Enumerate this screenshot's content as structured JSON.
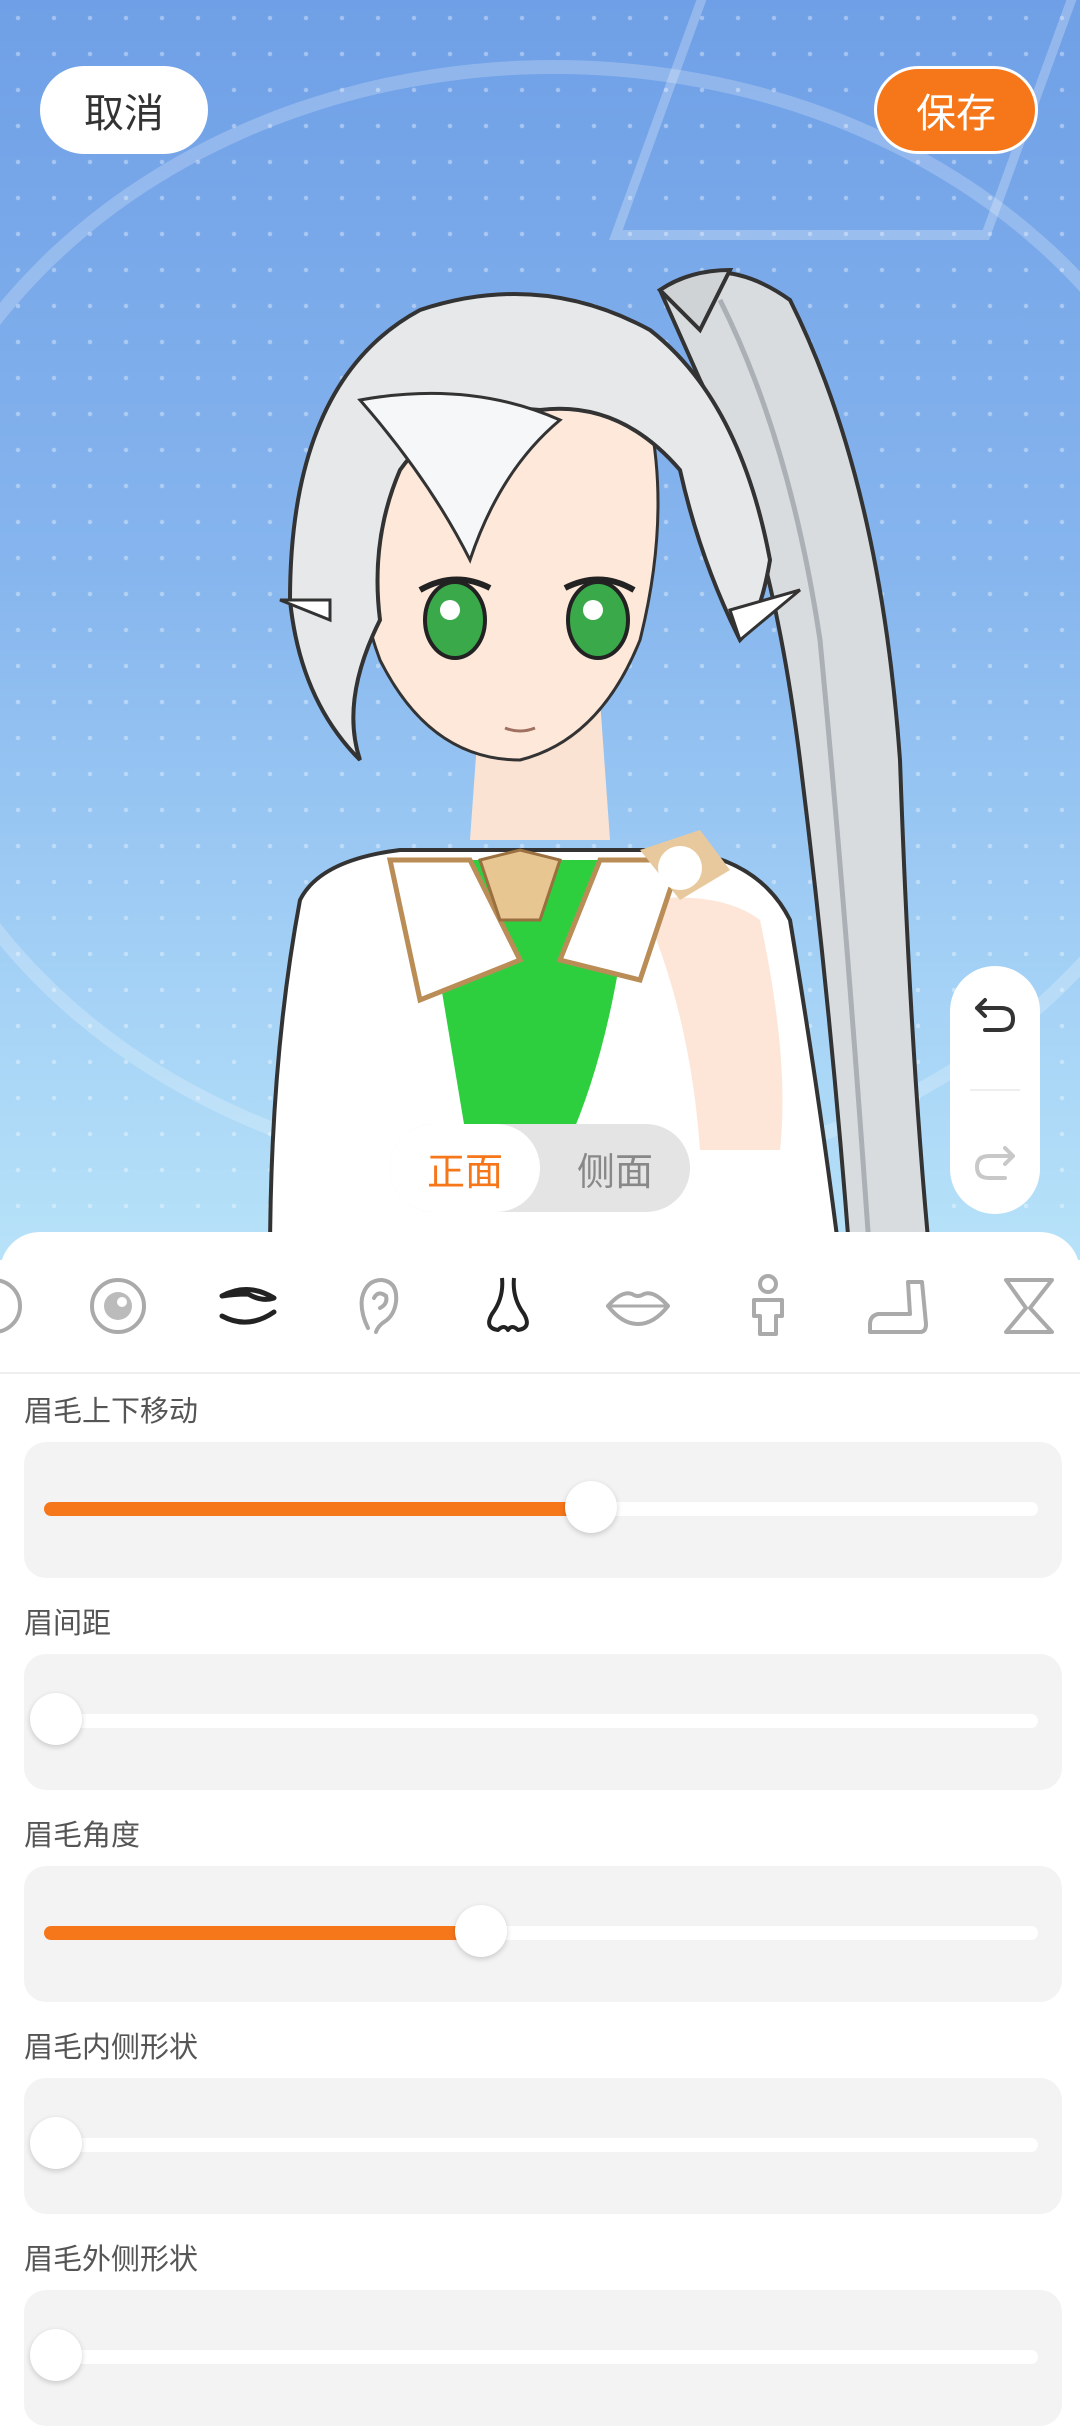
{
  "header": {
    "cancel_label": "取消",
    "save_label": "保存"
  },
  "view_toggle": {
    "options": [
      "正面",
      "侧面"
    ],
    "selected": "正面"
  },
  "categories": [
    {
      "icon": "partial-icon"
    },
    {
      "icon": "eye-icon"
    },
    {
      "icon": "eyebrow-icon",
      "selected": true
    },
    {
      "icon": "ear-icon"
    },
    {
      "icon": "nose-icon"
    },
    {
      "icon": "lips-icon"
    },
    {
      "icon": "body-icon"
    },
    {
      "icon": "arm-icon"
    },
    {
      "icon": "leg-icon"
    }
  ],
  "sliders": [
    {
      "label": "眉毛上下移动",
      "value": 0.55
    },
    {
      "label": "眉间距",
      "value": 0.0
    },
    {
      "label": "眉毛角度",
      "value": 0.44
    },
    {
      "label": "眉毛内侧形状",
      "value": 0.0
    },
    {
      "label": "眉毛外侧形状",
      "value": 0.0
    }
  ],
  "colors": {
    "accent": "#f6761a",
    "track": "#ffffff",
    "card": "#f3f3f3"
  }
}
